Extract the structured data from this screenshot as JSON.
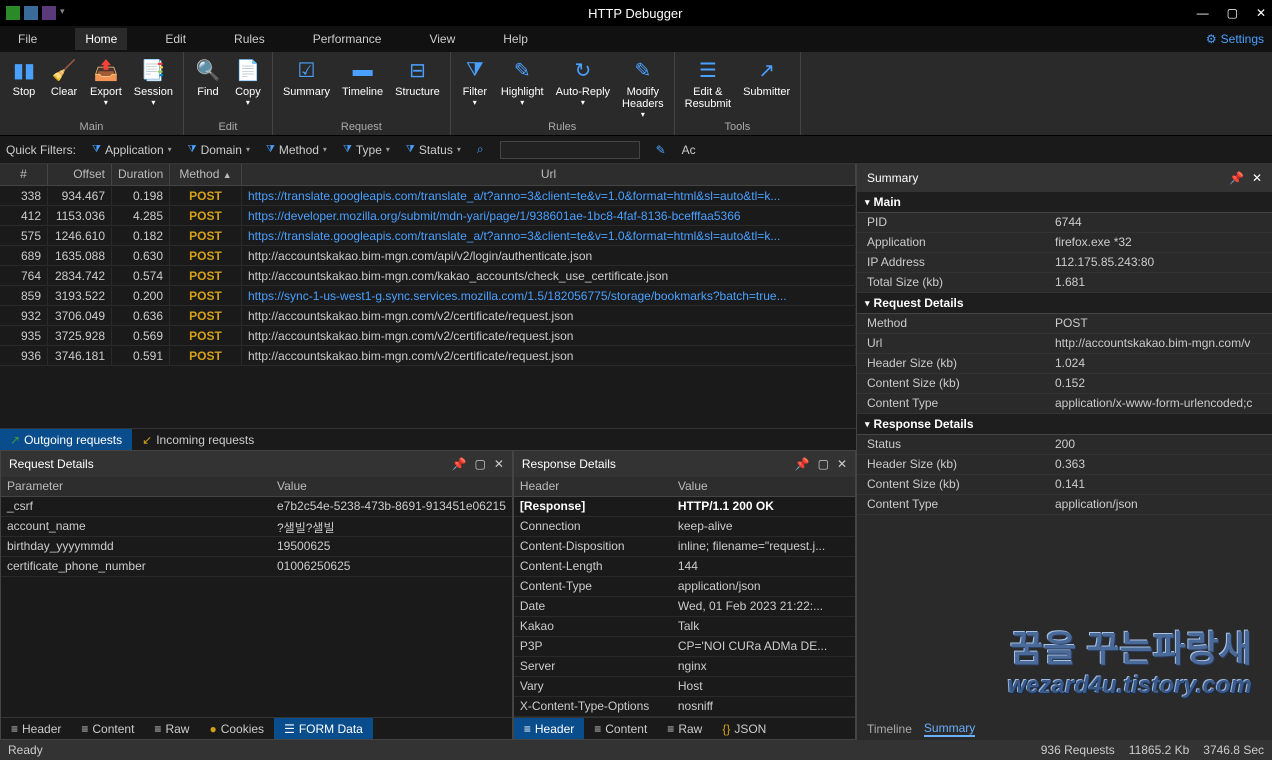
{
  "window": {
    "title": "HTTP Debugger"
  },
  "menu": {
    "file": "File",
    "home": "Home",
    "edit": "Edit",
    "rules": "Rules",
    "performance": "Performance",
    "view": "View",
    "help": "Help",
    "settings": "Settings"
  },
  "ribbon": {
    "main": {
      "name": "Main",
      "stop": "Stop",
      "clear": "Clear",
      "export": "Export",
      "session": "Session"
    },
    "edit": {
      "name": "Edit",
      "find": "Find",
      "copy": "Copy"
    },
    "request": {
      "name": "Request",
      "summary": "Summary",
      "timeline": "Timeline",
      "structure": "Structure"
    },
    "rules": {
      "name": "Rules",
      "filter": "Filter",
      "highlight": "Highlight",
      "autoreply": "Auto-Reply",
      "modify": "Modify\nHeaders"
    },
    "tools": {
      "name": "Tools",
      "editresubmit": "Edit &\nResubmit",
      "submitter": "Submitter"
    }
  },
  "qf": {
    "label": "Quick Filters:",
    "application": "Application",
    "domain": "Domain",
    "method": "Method",
    "type": "Type",
    "status": "Status",
    "ac": "Ac"
  },
  "grid": {
    "headers": {
      "n": "#",
      "offset": "Offset",
      "duration": "Duration",
      "method": "Method",
      "url": "Url"
    },
    "rows": [
      {
        "n": "338",
        "offset": "934.467",
        "duration": "0.198",
        "method": "POST",
        "url": "https://translate.googleapis.com/translate_a/t?anno=3&client=te&v=1.0&format=html&sl=auto&tl=k...",
        "link": true
      },
      {
        "n": "412",
        "offset": "1153.036",
        "duration": "4.285",
        "method": "POST",
        "url": "https://developer.mozilla.org/submit/mdn-yari/page/1/938601ae-1bc8-4faf-8136-bcefffaa5366",
        "link": true
      },
      {
        "n": "575",
        "offset": "1246.610",
        "duration": "0.182",
        "method": "POST",
        "url": "https://translate.googleapis.com/translate_a/t?anno=3&client=te&v=1.0&format=html&sl=auto&tl=k...",
        "link": true
      },
      {
        "n": "689",
        "offset": "1635.088",
        "duration": "0.630",
        "method": "POST",
        "url": "http://accountskakao.bim-mgn.com/api/v2/login/authenticate.json",
        "link": false
      },
      {
        "n": "764",
        "offset": "2834.742",
        "duration": "0.574",
        "method": "POST",
        "url": "http://accountskakao.bim-mgn.com/kakao_accounts/check_use_certificate.json",
        "link": false
      },
      {
        "n": "859",
        "offset": "3193.522",
        "duration": "0.200",
        "method": "POST",
        "url": "https://sync-1-us-west1-g.sync.services.mozilla.com/1.5/182056775/storage/bookmarks?batch=true...",
        "link": true
      },
      {
        "n": "932",
        "offset": "3706.049",
        "duration": "0.636",
        "method": "POST",
        "url": "http://accountskakao.bim-mgn.com/v2/certificate/request.json",
        "link": false
      },
      {
        "n": "935",
        "offset": "3725.928",
        "duration": "0.569",
        "method": "POST",
        "url": "http://accountskakao.bim-mgn.com/v2/certificate/request.json",
        "link": false
      },
      {
        "n": "936",
        "offset": "3746.181",
        "duration": "0.591",
        "method": "POST",
        "url": "http://accountskakao.bim-mgn.com/v2/certificate/request.json",
        "link": false
      }
    ]
  },
  "reqtabs": {
    "outgoing": "Outgoing requests",
    "incoming": "Incoming requests"
  },
  "reqdetails": {
    "title": "Request Details",
    "headers": {
      "param": "Parameter",
      "value": "Value"
    },
    "rows": [
      {
        "k": "_csrf",
        "v": "e7b2c54e-5238-473b-8691-913451e06215"
      },
      {
        "k": "account_name",
        "v": "?샐빌?샐빌"
      },
      {
        "k": "birthday_yyyymmdd",
        "v": "19500625"
      },
      {
        "k": "certificate_phone_number",
        "v": "01006250625"
      }
    ],
    "tabs": {
      "header": "Header",
      "content": "Content",
      "raw": "Raw",
      "cookies": "Cookies",
      "formdata": "FORM Data"
    }
  },
  "respdetails": {
    "title": "Response Details",
    "headers": {
      "header": "Header",
      "value": "Value"
    },
    "rows": [
      {
        "k": "[Response]",
        "v": "HTTP/1.1 200 OK",
        "bold": true
      },
      {
        "k": "Connection",
        "v": "keep-alive"
      },
      {
        "k": "Content-Disposition",
        "v": "inline; filename=\"request.j..."
      },
      {
        "k": "Content-Length",
        "v": "144"
      },
      {
        "k": "Content-Type",
        "v": "application/json"
      },
      {
        "k": "Date",
        "v": "Wed, 01 Feb 2023 21:22:..."
      },
      {
        "k": "Kakao",
        "v": "Talk"
      },
      {
        "k": "P3P",
        "v": "CP='NOI CURa ADMa DE..."
      },
      {
        "k": "Server",
        "v": "nginx"
      },
      {
        "k": "Vary",
        "v": "Host"
      },
      {
        "k": "X-Content-Type-Options",
        "v": "nosniff"
      }
    ],
    "tabs": {
      "header": "Header",
      "content": "Content",
      "raw": "Raw",
      "json": "JSON"
    }
  },
  "summary": {
    "title": "Summary",
    "sections": {
      "main": {
        "name": "Main",
        "rows": [
          {
            "k": "PID",
            "v": "6744"
          },
          {
            "k": "Application",
            "v": "firefox.exe *32"
          },
          {
            "k": "IP Address",
            "v": "112.175.85.243:80"
          },
          {
            "k": "Total Size (kb)",
            "v": "1.681"
          }
        ]
      },
      "request": {
        "name": "Request Details",
        "rows": [
          {
            "k": "Method",
            "v": "POST"
          },
          {
            "k": "Url",
            "v": "http://accountskakao.bim-mgn.com/v"
          },
          {
            "k": "Header Size (kb)",
            "v": "1.024"
          },
          {
            "k": "Content Size (kb)",
            "v": "0.152"
          },
          {
            "k": "Content Type",
            "v": "application/x-www-form-urlencoded;c"
          }
        ]
      },
      "response": {
        "name": "Response Details",
        "rows": [
          {
            "k": "Status",
            "v": "200"
          },
          {
            "k": "Header Size (kb)",
            "v": "0.363"
          },
          {
            "k": "Content Size (kb)",
            "v": "0.141"
          },
          {
            "k": "Content Type",
            "v": "application/json"
          }
        ]
      }
    },
    "tabs": {
      "timeline": "Timeline",
      "summary": "Summary"
    }
  },
  "status": {
    "ready": "Ready",
    "requests": "936 Requests",
    "size": "11865.2 Kb",
    "time": "3746.8 Sec"
  },
  "watermark": {
    "line1": "꿈을 꾸는파랑새",
    "line2": "wezard4u.tistory.com"
  }
}
